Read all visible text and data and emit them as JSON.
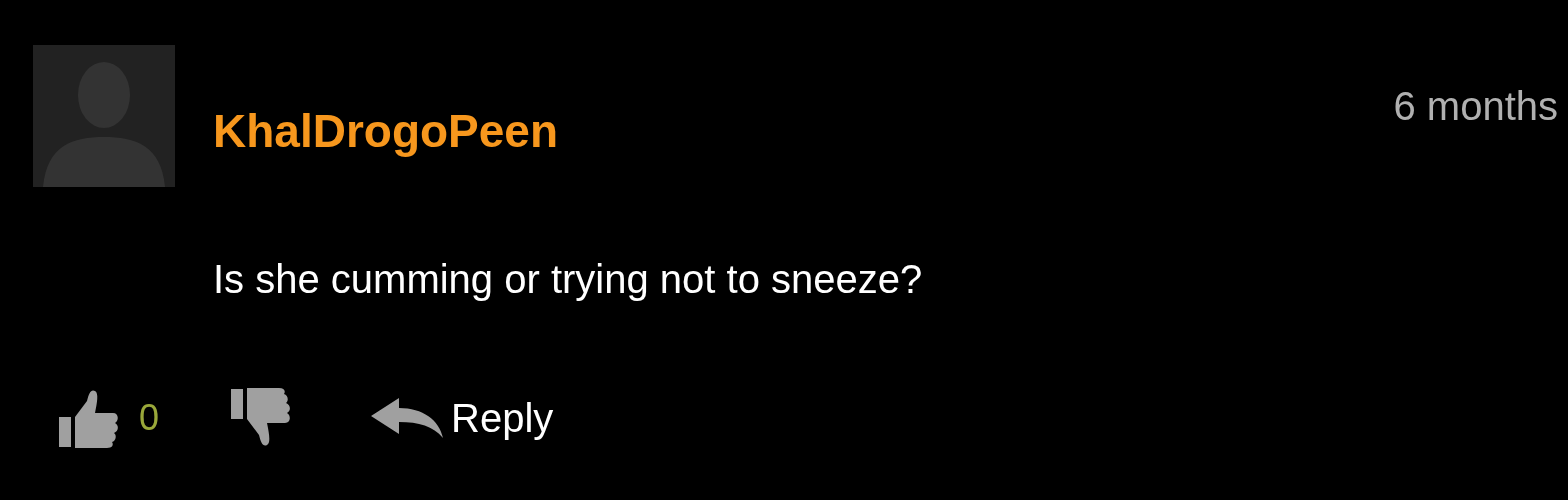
{
  "comment": {
    "username": "KhalDrogoPeen",
    "time": "6 months",
    "text": "Is she cumming or trying not to sneeze?",
    "likes": "0",
    "reply": "Reply"
  }
}
